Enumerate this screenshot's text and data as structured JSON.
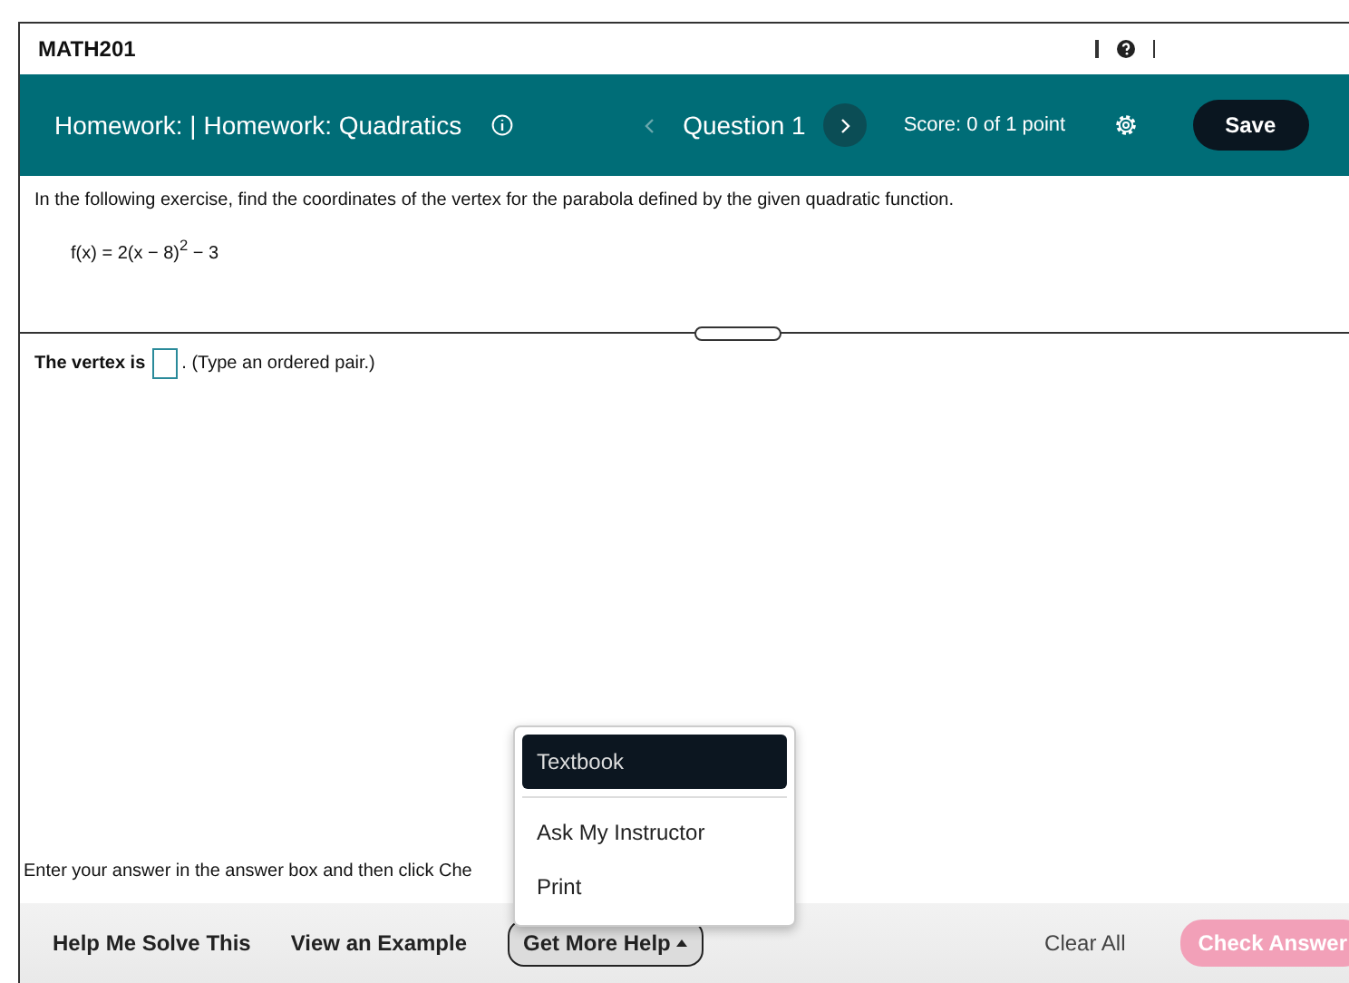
{
  "header": {
    "course": "MATH201"
  },
  "toolbar": {
    "title": "Homework: | Homework: Quadratics",
    "previous": {
      "disabled": true
    },
    "question": "Question 1",
    "next": {
      "disabled": false
    },
    "score": "Score: 0 of 1 point",
    "save": "Save"
  },
  "question": {
    "instruction": "In the following exercise, find the coordinates of the vertex for the parabola defined by the given quadratic function.",
    "formula": "f(x) = 2(x − 8)$^{2}$ − 3"
  },
  "answer": {
    "prefix": "The vertex is",
    "suffix": ". (Type an ordered pair.)"
  },
  "footer_hint": "Enter your answer in the answer box and then click Che",
  "help_menu": [
    {
      "label": "Textbook",
      "selected": true
    },
    {
      "label": "Ask My Instructor",
      "selected": false
    },
    {
      "label": "Print",
      "selected": false
    }
  ],
  "bottom_bar": {
    "help_solve": "Help Me Solve This",
    "example": "View an Example",
    "more_help": {
      "label": "Get More Help",
      "expanded": true
    },
    "clear": "Clear All",
    "check": {
      "label": "Check Answer",
      "disabled": true
    }
  }
}
